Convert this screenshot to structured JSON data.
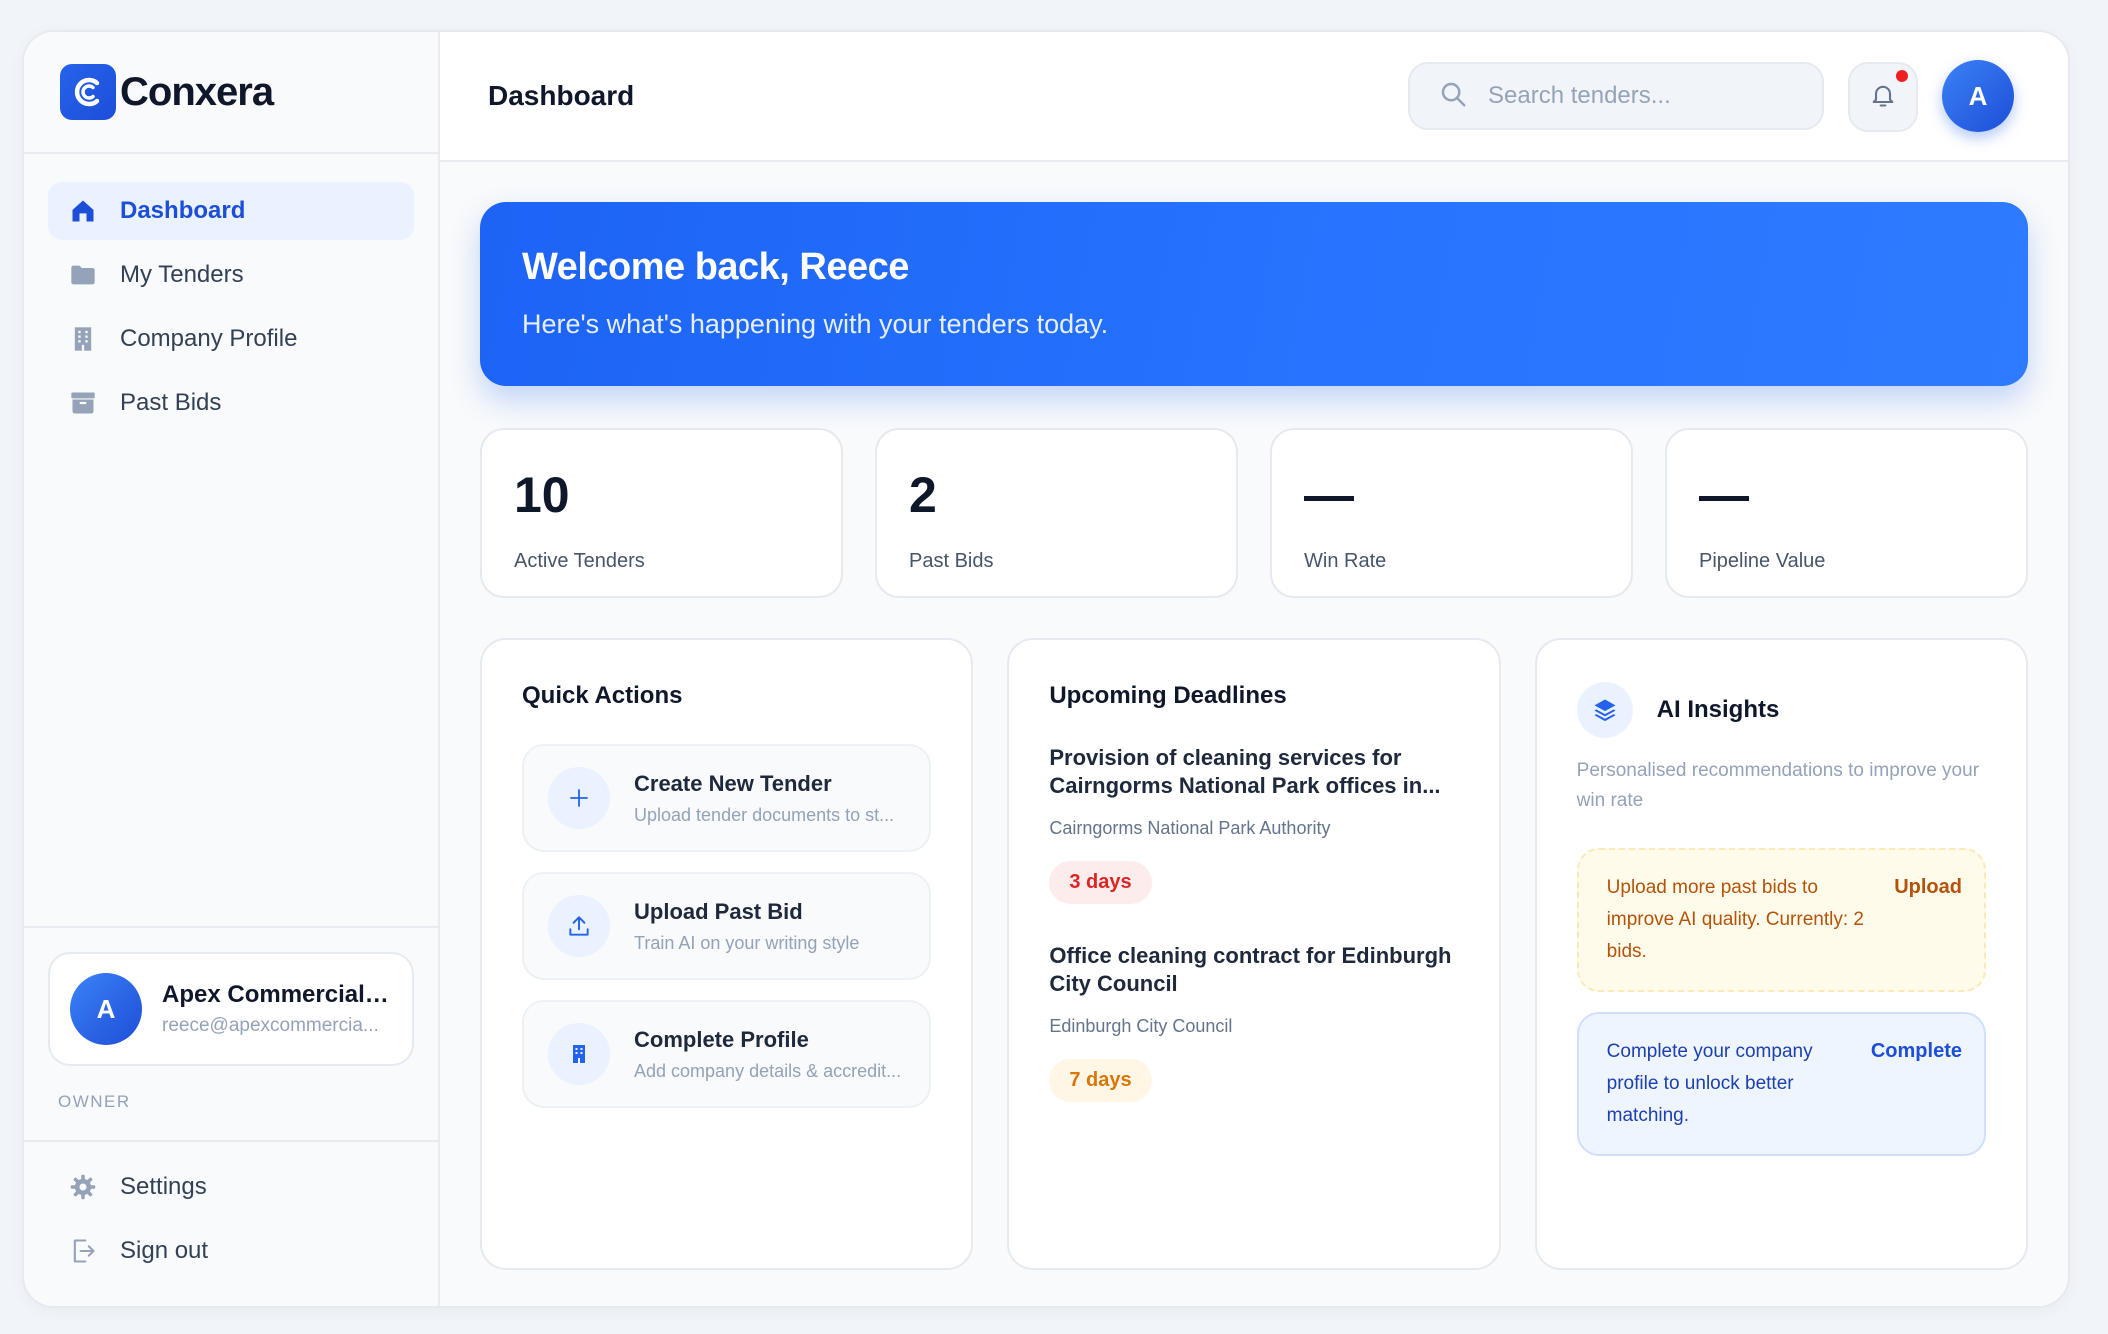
{
  "brand": {
    "name": "Conxera"
  },
  "sidebar": {
    "items": [
      {
        "label": "Dashboard",
        "icon": "home-icon",
        "active": true
      },
      {
        "label": "My Tenders",
        "icon": "folder-icon",
        "active": false
      },
      {
        "label": "Company Profile",
        "icon": "building-icon",
        "active": false
      },
      {
        "label": "Past Bids",
        "icon": "archive-icon",
        "active": false
      }
    ],
    "account": {
      "initial": "A",
      "name": "Apex Commercial C...",
      "email": "reece@apexcommercia...",
      "role": "OWNER"
    },
    "bottom": [
      {
        "label": "Settings",
        "icon": "gear-icon"
      },
      {
        "label": "Sign out",
        "icon": "sign-out-icon"
      }
    ]
  },
  "header": {
    "title": "Dashboard",
    "search_placeholder": "Search tenders...",
    "user_initial": "A"
  },
  "hero": {
    "title": "Welcome back, Reece",
    "subtitle": "Here's what's happening with your tenders today."
  },
  "stats": [
    {
      "value": "10",
      "label": "Active Tenders"
    },
    {
      "value": "2",
      "label": "Past Bids"
    },
    {
      "value": "—",
      "label": "Win Rate"
    },
    {
      "value": "—",
      "label": "Pipeline Value"
    }
  ],
  "quick_actions": {
    "title": "Quick Actions",
    "items": [
      {
        "title": "Create New Tender",
        "subtitle": "Upload tender documents to st...",
        "icon": "plus-icon"
      },
      {
        "title": "Upload Past Bid",
        "subtitle": "Train AI on your writing style",
        "icon": "upload-icon"
      },
      {
        "title": "Complete Profile",
        "subtitle": "Add company details & accredit...",
        "icon": "building-icon"
      }
    ]
  },
  "deadlines": {
    "title": "Upcoming Deadlines",
    "items": [
      {
        "title": "Provision of cleaning services for Cairngorms National Park offices in...",
        "org": "Cairngorms National Park Authority",
        "due": "3 days",
        "urgency": "red"
      },
      {
        "title": "Office cleaning contract for Edinburgh City Council",
        "org": "Edinburgh City Council",
        "due": "7 days",
        "urgency": "amber"
      }
    ]
  },
  "ai_insights": {
    "title": "AI Insights",
    "subtitle": "Personalised recommendations to improve your win rate",
    "cards": [
      {
        "text": "Upload more past bids to improve AI quality. Currently: 2 bids.",
        "action": "Upload"
      },
      {
        "text": "Complete your company profile to unlock better matching.",
        "action": "Complete"
      }
    ]
  },
  "colors": {
    "accent": "#2563eb",
    "notification": "#ef1f1f",
    "urgent": "#dc2626",
    "warning": "#d97706"
  }
}
